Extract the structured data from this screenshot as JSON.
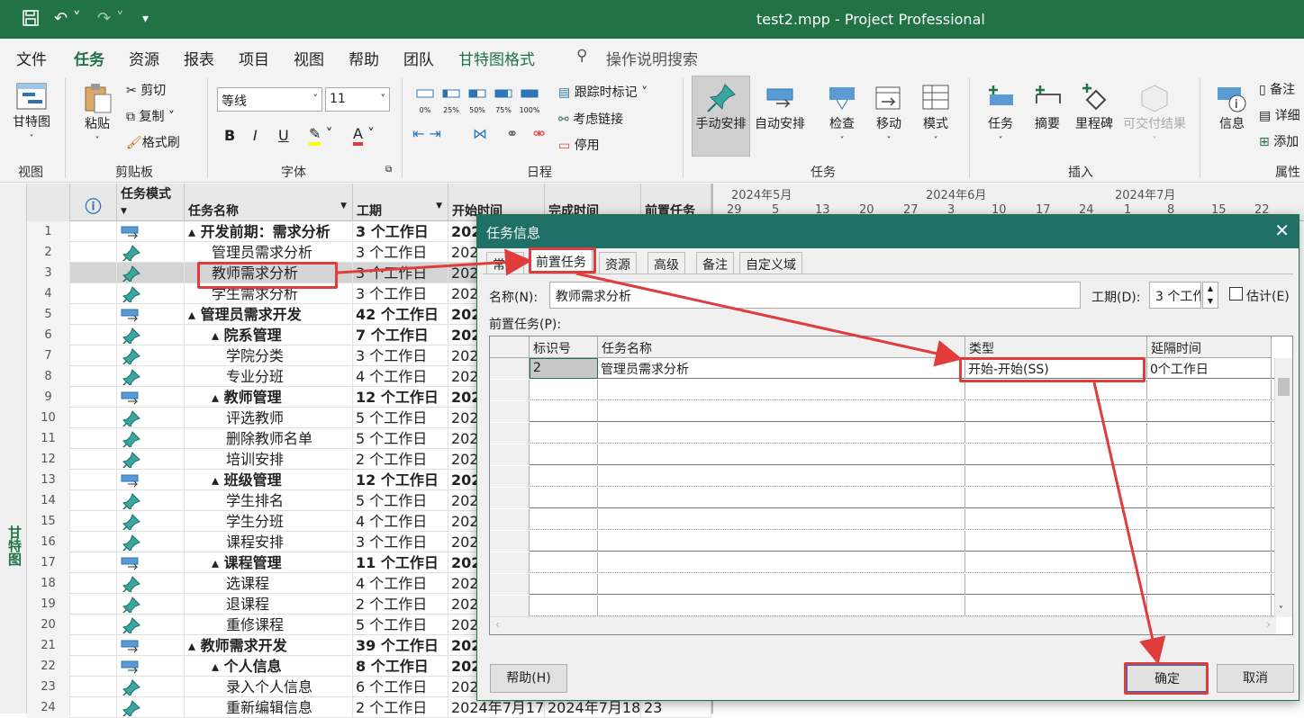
{
  "window": {
    "title": "test2.mpp  -  Project Professional"
  },
  "tabs": [
    "文件",
    "任务",
    "资源",
    "报表",
    "项目",
    "视图",
    "帮助",
    "团队",
    "甘特图格式"
  ],
  "tab_active": "任务",
  "search_label": "操作说明搜索",
  "ribbon": {
    "view": {
      "gantt_label": "甘特图",
      "group": "视图"
    },
    "clipboard": {
      "paste": "粘贴",
      "cut": "剪切",
      "copy": "复制",
      "format_painter": "格式刷",
      "group": "剪贴板"
    },
    "font": {
      "name": "等线",
      "size": "11",
      "bold": "B",
      "italic": "I",
      "underline": "U",
      "group": "字体"
    },
    "schedule": {
      "percents": [
        "0%",
        "25%",
        "50%",
        "75%",
        "100%"
      ],
      "mark_on_track": "跟踪时标记",
      "respect_links": "考虑链接",
      "inactivate": "停用",
      "group": "日程"
    },
    "tasks": {
      "manual": "手动安排",
      "auto": "自动安排",
      "inspect": "检查",
      "move": "移动",
      "mode": "模式",
      "group": "任务"
    },
    "insert": {
      "task": "任务",
      "summary": "摘要",
      "milestone": "里程碑",
      "deliverable": "可交付结果",
      "group": "插入"
    },
    "properties": {
      "info": "信息",
      "notes": "备注",
      "details": "详细",
      "add": "添加",
      "group": "属性"
    }
  },
  "sidebar_label": "甘特图",
  "grid": {
    "headers": {
      "info": "ⓘ",
      "mode": "任务模式",
      "name": "任务名称",
      "duration": "工期",
      "start": "开始时间",
      "finish": "完成时间",
      "pred": "前置任务"
    },
    "rows": [
      {
        "id": "1",
        "name": "▴ 开发前期：需求分析",
        "dur": "3 个工作日",
        "start": "202",
        "level": 0,
        "bold": true,
        "auto": true
      },
      {
        "id": "2",
        "name": "管理员需求分析",
        "dur": "3 个工作日",
        "start": "202",
        "level": 1,
        "bold": false,
        "auto": false
      },
      {
        "id": "3",
        "name": "教师需求分析",
        "dur": "3 个工作日",
        "start": "202",
        "level": 1,
        "bold": false,
        "auto": false
      },
      {
        "id": "4",
        "name": "学生需求分析",
        "dur": "3 个工作日",
        "start": "202",
        "level": 1,
        "bold": false,
        "auto": false
      },
      {
        "id": "5",
        "name": "▴ 管理员需求开发",
        "dur": "42 个工作日",
        "start": "202",
        "level": 0,
        "bold": true,
        "auto": true
      },
      {
        "id": "6",
        "name": "▴ 院系管理",
        "dur": "7 个工作日",
        "start": "202",
        "level": 1,
        "bold": true,
        "auto": false
      },
      {
        "id": "7",
        "name": "学院分类",
        "dur": "3 个工作日",
        "start": "202",
        "level": 2,
        "bold": false,
        "auto": false
      },
      {
        "id": "8",
        "name": "专业分班",
        "dur": "4 个工作日",
        "start": "202",
        "level": 2,
        "bold": false,
        "auto": false
      },
      {
        "id": "9",
        "name": "▴ 教师管理",
        "dur": "12 个工作日",
        "start": "202",
        "level": 1,
        "bold": true,
        "auto": true
      },
      {
        "id": "10",
        "name": "评选教师",
        "dur": "5 个工作日",
        "start": "202",
        "level": 2,
        "bold": false,
        "auto": false
      },
      {
        "id": "11",
        "name": "删除教师名单",
        "dur": "5 个工作日",
        "start": "202",
        "level": 2,
        "bold": false,
        "auto": false
      },
      {
        "id": "12",
        "name": "培训安排",
        "dur": "2 个工作日",
        "start": "202",
        "level": 2,
        "bold": false,
        "auto": false
      },
      {
        "id": "13",
        "name": "▴ 班级管理",
        "dur": "12 个工作日",
        "start": "202",
        "level": 1,
        "bold": true,
        "auto": true
      },
      {
        "id": "14",
        "name": "学生排名",
        "dur": "5 个工作日",
        "start": "202",
        "level": 2,
        "bold": false,
        "auto": false
      },
      {
        "id": "15",
        "name": "学生分班",
        "dur": "4 个工作日",
        "start": "202",
        "level": 2,
        "bold": false,
        "auto": false
      },
      {
        "id": "16",
        "name": "课程安排",
        "dur": "3 个工作日",
        "start": "202",
        "level": 2,
        "bold": false,
        "auto": false
      },
      {
        "id": "17",
        "name": "▴ 课程管理",
        "dur": "11 个工作日",
        "start": "202",
        "level": 1,
        "bold": true,
        "auto": true
      },
      {
        "id": "18",
        "name": "选课程",
        "dur": "4 个工作日",
        "start": "202",
        "level": 2,
        "bold": false,
        "auto": false
      },
      {
        "id": "19",
        "name": "退课程",
        "dur": "2 个工作日",
        "start": "202",
        "level": 2,
        "bold": false,
        "auto": false
      },
      {
        "id": "20",
        "name": "重修课程",
        "dur": "5 个工作日",
        "start": "202",
        "level": 2,
        "bold": false,
        "auto": false
      },
      {
        "id": "21",
        "name": "▴ 教师需求开发",
        "dur": "39 个工作日",
        "start": "202",
        "level": 0,
        "bold": true,
        "auto": true
      },
      {
        "id": "22",
        "name": "▴ 个人信息",
        "dur": "8 个工作日",
        "start": "202",
        "level": 1,
        "bold": true,
        "auto": true
      },
      {
        "id": "23",
        "name": "录入个人信息",
        "dur": "6 个工作日",
        "start": "202",
        "level": 2,
        "bold": false,
        "auto": false
      },
      {
        "id": "24",
        "name": "重新编辑信息",
        "dur": "2 个工作日",
        "start": "2024年7月17",
        "finish": "2024年7月18",
        "pred": "23",
        "level": 2,
        "bold": false,
        "auto": false
      }
    ]
  },
  "timeline": {
    "months": [
      "2024年5月",
      "2024年6月",
      "2024年7月"
    ],
    "days": [
      "29",
      "5",
      "13",
      "20",
      "27",
      "3",
      "10",
      "17",
      "24",
      "1",
      "8",
      "15",
      "22"
    ]
  },
  "dialog": {
    "title": "任务信息",
    "tabs": [
      "常规",
      "前置任务",
      "资源",
      "高级",
      "备注",
      "自定义域"
    ],
    "name_label": "名称(N):",
    "name_value": "教师需求分析",
    "duration_label": "工期(D):",
    "duration_value": "3 个工作",
    "estimate_label": "估计(E)",
    "pred_label": "前置任务(P):",
    "table_headers": [
      "标识号",
      "任务名称",
      "类型",
      "延隔时间"
    ],
    "table_rows": [
      {
        "id": "2",
        "name": "管理员需求分析",
        "type": "开始-开始(SS)",
        "lag": "0个工作日"
      }
    ],
    "help_button": "帮助(H)",
    "ok_button": "确定",
    "cancel_button": "取消"
  },
  "colors": {
    "brand": "#217346",
    "dialog_title": "#1f7066",
    "annotation": "#e03c3c"
  }
}
